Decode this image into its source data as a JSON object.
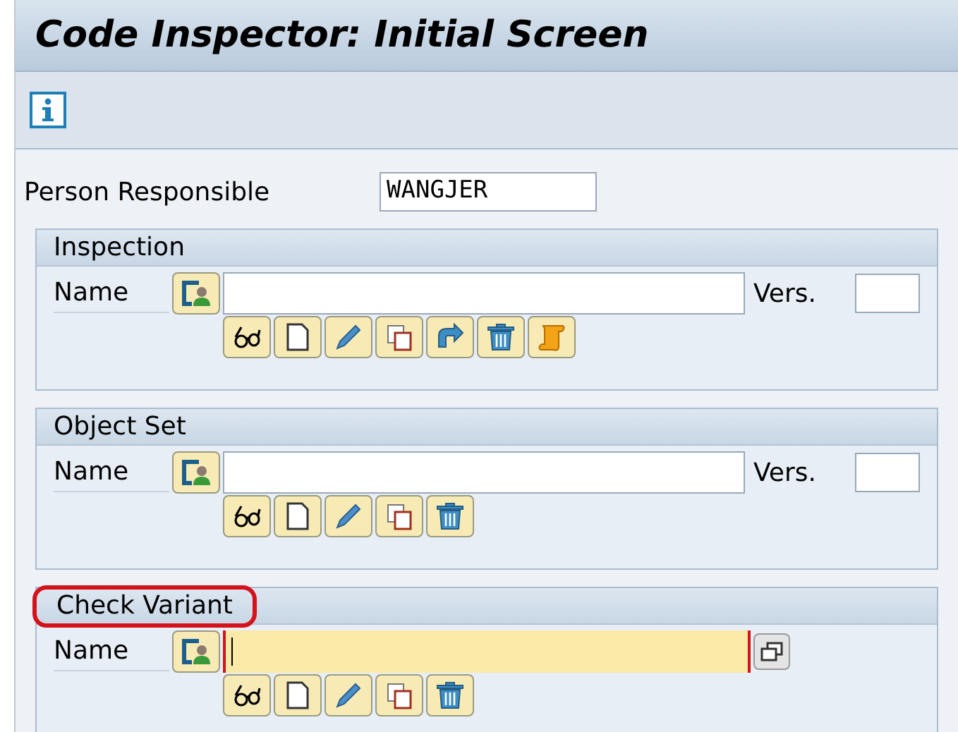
{
  "window": {
    "title": "Code Inspector: Initial Screen"
  },
  "person": {
    "label": "Person Responsible",
    "value": "WANGJER"
  },
  "sections": [
    {
      "title": "Inspection",
      "highlighted": false,
      "name_label": "Name",
      "focused": false,
      "version_label": "Vers.",
      "buttons": [
        {
          "kind": "display"
        },
        {
          "kind": "create"
        },
        {
          "kind": "change"
        },
        {
          "kind": "copy"
        },
        {
          "kind": "rename"
        },
        {
          "kind": "delete"
        },
        {
          "kind": "results"
        }
      ]
    },
    {
      "title": "Object Set",
      "highlighted": false,
      "name_label": "Name",
      "focused": false,
      "version_label": "Vers.",
      "buttons": [
        {
          "kind": "display"
        },
        {
          "kind": "create"
        },
        {
          "kind": "change"
        },
        {
          "kind": "copy"
        },
        {
          "kind": "delete"
        }
      ]
    },
    {
      "title": "Check Variant",
      "highlighted": true,
      "name_label": "Name",
      "focused": true,
      "buttons": [
        {
          "kind": "display"
        },
        {
          "kind": "create"
        },
        {
          "kind": "change"
        },
        {
          "kind": "copy"
        },
        {
          "kind": "delete"
        }
      ]
    }
  ]
}
